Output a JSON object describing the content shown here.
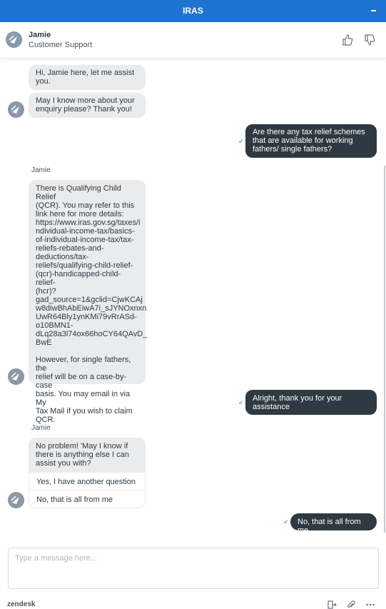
{
  "window": {
    "title": "IRAS"
  },
  "agent": {
    "name": "Jamie",
    "title": "Customer Support"
  },
  "messages": {
    "m1": "Hi, Jamie here, let me assist\nyou.",
    "m2": "May I know more about your\nenquiry please? Thank you!",
    "u1": "Are there any tax relief schemes\nthat are available for working\nfathers/ single fathers?",
    "sender1": "Jamie",
    "m3": "There is Qualifying Child Relief\n(QCR). You may refer to this\nlink here for more details:\nhttps://www.iras.gov.sg/taxes/i\nndividual-income-tax/basics-\nof-individual-income-tax/tax-\nreliefs-rebates-and-\ndeductions/tax-\nreliefs/qualifying-child-relief-\n(qcr)-handicapped-child-relief-\n(hcr)?\ngad_source=1&gclid=CjwKCAj\nw8diwBhAbEiwA7i_sJYNOxnxn\nUwR64Bly1ynKMi79vRrASd-\no10BMN1-\ndLq28a3l74ox66hoCY64QAvD_\nBwE\n\nHowever, for single fathers, the\nrelief will be on a case-by-case\nbasis. You may email in via My\nTax Mail if you wish to claim\nQCR.",
    "u2": "Alright, thank you for your\nassistance",
    "sender2": "Jamie",
    "m4": "No problem! 'May I know if\nthere is anything else I can\nassist you with?",
    "u3": "No, that is all from me"
  },
  "quick_replies": [
    "Yes, I have another question",
    "No, that is all from me"
  ],
  "composer": {
    "placeholder": "Type a message here..."
  },
  "footer": {
    "brand": "zendesk"
  },
  "colors": {
    "titlebar": "#1f73d1",
    "user_bubble": "#2f3941",
    "agent_bubble": "#e9ebed"
  },
  "icons": [
    "minimize-icon",
    "avatar-icon",
    "thumbs-up-icon",
    "thumbs-down-icon",
    "check-icon",
    "end-chat-icon",
    "attachment-icon",
    "more-icon"
  ]
}
